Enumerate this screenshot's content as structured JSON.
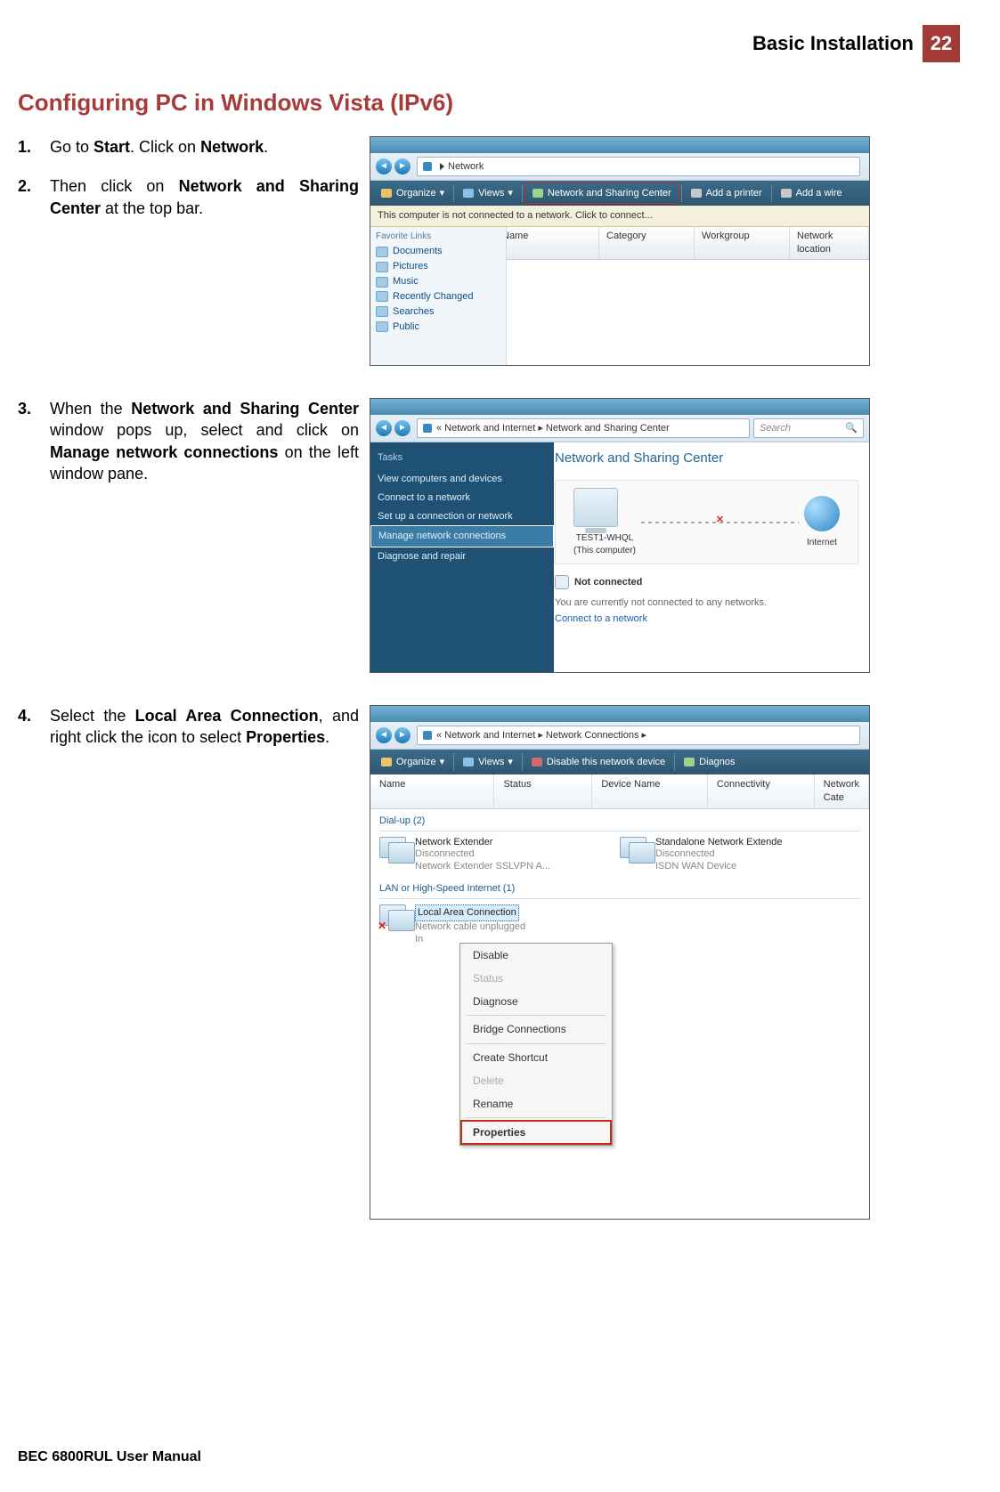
{
  "header": {
    "title": "Basic Installation",
    "page": "22"
  },
  "section_title": "Configuring PC in Windows Vista (IPv6)",
  "steps": [
    {
      "num": "1.",
      "plain_a": "Go to ",
      "bold_a": "Start",
      "plain_b": ". Click on ",
      "bold_b": "Network",
      "plain_c": "."
    },
    {
      "num": "2.",
      "plain_a": "Then click on ",
      "bold_a": "Network and Sharing Center",
      "plain_b": " at the top bar."
    },
    {
      "num": "3.",
      "plain_a": "When the ",
      "bold_a": "Network and Sharing Center",
      "plain_b": " window pops up, select and click on ",
      "bold_b": "Manage network connections",
      "plain_c": " on the left window pane."
    },
    {
      "num": "4.",
      "plain_a": "Select the ",
      "bold_a": "Local Area Connection",
      "plain_b": ", and right click the icon to select ",
      "bold_b": "Properties",
      "plain_c": "."
    }
  ],
  "ss1": {
    "breadcrumb_arrow": "▸",
    "breadcrumb": "Network",
    "toolbar": {
      "organize": "Organize",
      "views": "Views",
      "nsc": "Network and Sharing Center",
      "add_printer": "Add a printer",
      "add_wire": "Add a wire"
    },
    "info": "This computer is not connected to a network. Click to connect...",
    "fav_title": "Favorite Links",
    "favs": [
      "Documents",
      "Pictures",
      "Music",
      "Recently Changed",
      "Searches",
      "Public"
    ],
    "cols": [
      "Name",
      "Category",
      "Workgroup",
      "Network location"
    ]
  },
  "ss2": {
    "breadcrumb": "« Network and Internet  ▸  Network and Sharing Center",
    "search": "Search",
    "tasks_title": "Tasks",
    "tasks": [
      "View computers and devices",
      "Connect to a network",
      "Set up a connection or network",
      "Manage network connections",
      "Diagnose and repair"
    ],
    "selected_task_index": 3,
    "main_title": "Network and Sharing Center",
    "pc_label": "TEST1-WHQL",
    "pc_sub": "(This computer)",
    "net_label": "Internet",
    "not_connected": "Not connected",
    "msg": "You are currently not connected to any networks.",
    "link": "Connect to a network"
  },
  "ss3": {
    "breadcrumb": "«  Network and Internet  ▸  Network Connections  ▸",
    "toolbar": {
      "organize": "Organize",
      "views": "Views",
      "disable": "Disable this network device",
      "diagnos": "Diagnos"
    },
    "cols": [
      "Name",
      "Status",
      "Device Name",
      "Connectivity",
      "Network Cate"
    ],
    "group1": "Dial-up (2)",
    "item1": {
      "name": "Network Extender",
      "status": "Disconnected",
      "device": "Network Extender SSLVPN A..."
    },
    "item2": {
      "name": "Standalone Network Extende",
      "status": "Disconnected",
      "device": "ISDN WAN Device"
    },
    "group2": "LAN or High-Speed Internet (1)",
    "item3": {
      "name": "Local Area Connection",
      "status": "Network cable unplugged",
      "device": "In"
    },
    "menu": [
      "Disable",
      "Status",
      "Diagnose",
      "Bridge Connections",
      "Create Shortcut",
      "Delete",
      "Rename",
      "Properties"
    ],
    "disabled_items": [
      1,
      5
    ],
    "selected_item": 7
  },
  "footer": "BEC 6800RUL User Manual"
}
